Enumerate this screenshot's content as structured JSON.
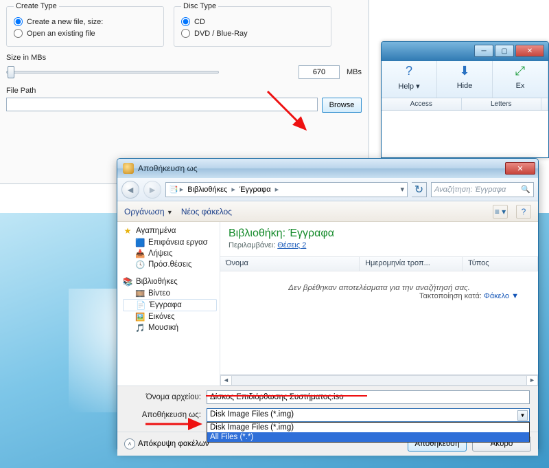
{
  "app_panel": {
    "create_type_legend": "Create Type",
    "radio_new": "Create a new file, size:",
    "radio_open": "Open an existing file",
    "disc_type_legend": "Disc Type",
    "radio_cd": "CD",
    "radio_dvd": "DVD / Blue-Ray",
    "size_label": "Size in MBs",
    "size_value": "670",
    "size_unit": "MBs",
    "filepath_label": "File Path",
    "filepath_value": "",
    "browse": "Browse"
  },
  "parent_window": {
    "toolbar": {
      "help": "Help",
      "hide": "Hide",
      "ex": "Ex"
    },
    "columns": {
      "access": "Access",
      "letters": "Letters"
    }
  },
  "dialog": {
    "title": "Αποθήκευση ως",
    "breadcrumb": {
      "root_icon": "⌂",
      "lib": "Βιβλιοθήκες",
      "docs": "Έγγραφα"
    },
    "search_placeholder": "Αναζήτηση: Έγγραφα",
    "cmd_organize": "Οργάνωση",
    "cmd_newfolder": "Νέος φάκελος",
    "sidebar": {
      "favorites": {
        "label": "Αγαπημένα",
        "items": [
          "Επιφάνεια εργασ",
          "Λήψεις",
          "Πρόσ.θέσεις"
        ]
      },
      "libraries": {
        "label": "Βιβλιοθήκες",
        "items": [
          "Βίντεο",
          "Έγγραφα",
          "Εικόνες",
          "Μουσική"
        ]
      }
    },
    "main": {
      "heading": "Βιβλιοθήκη: Έγγραφα",
      "sub_pre": "Περιλαμβάνει:",
      "sub_link": "Θέσεις 2",
      "sort_label": "Τακτοποίηση κατά:",
      "sort_value": "Φάκελο",
      "col_name": "Όνομα",
      "col_date": "Ημερομηνία τροπ...",
      "col_type": "Τύπος",
      "empty": "Δεν βρέθηκαν αποτελέσματα για την αναζήτησή σας."
    },
    "filename_label": "Όνομα αρχείου:",
    "filename_value": "Δίσκος Επιδιόρθωσης Συστήματος.iso",
    "filetype_label": "Αποθήκευση ως:",
    "filetype_selected": "Disk Image Files (*.img)",
    "filetype_options": [
      "Disk Image Files (*.img)",
      "All Files (*.*)"
    ],
    "hide_folders": "Απόκρυψη φακέλων",
    "btn_save": "Αποθήκευση",
    "btn_cancel": "Άκυρο"
  }
}
